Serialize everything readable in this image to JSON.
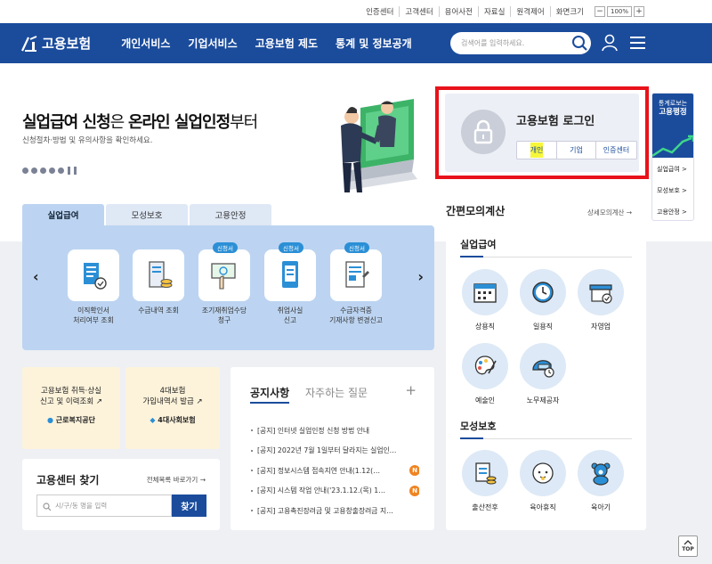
{
  "util": {
    "items": [
      "인증센터",
      "고객센터",
      "용어사전",
      "자료실",
      "원격제어",
      "화면크기"
    ],
    "zoom_minus": "−",
    "zoom_value": "100%",
    "zoom_plus": "+"
  },
  "gnb": {
    "logo": "고용보험",
    "menu": [
      "개인서비스",
      "기업서비스",
      "고용보험 제도",
      "통계 및 정보공개"
    ],
    "search_placeholder": "검색어를 입력하세요."
  },
  "hero": {
    "title_a": "실업급여 신청",
    "title_b": "은 ",
    "title_c": "온라인 실업인정",
    "title_d": "부터",
    "subtitle": "신청절차·방법 및 유의사항을 확인하세요."
  },
  "login": {
    "title": "고용보험 로그인",
    "buttons": [
      "개인",
      "기업",
      "인증센터"
    ],
    "highlight_color": "#f7f73a",
    "frame_color": "#e8121a"
  },
  "stat": {
    "line1": "통계로보는",
    "line2": "고용행정",
    "links": [
      "실업급여 >",
      "모성보호 >",
      "고용안정 >"
    ]
  },
  "tabs": [
    "실업급여",
    "모성보호",
    "고용안정"
  ],
  "services": [
    {
      "label1": "이직확인서",
      "label2": "처리여부 조회",
      "tag": ""
    },
    {
      "label1": "수급내역 조회",
      "label2": "",
      "tag": ""
    },
    {
      "label1": "조기재취업수당",
      "label2": "청구",
      "tag": "신청서"
    },
    {
      "label1": "취업사실",
      "label2": "신고",
      "tag": "신청서"
    },
    {
      "label1": "수급자격증",
      "label2": "기재사항 변경신고",
      "tag": "신청서"
    }
  ],
  "cards": [
    {
      "l1": "고용보험 취득·상실",
      "l2": "신고 및 이력조회",
      "org": "근로복지공단"
    },
    {
      "l1": "4대보험",
      "l2": "가입내역서 발급",
      "org": "4대사회보험"
    }
  ],
  "find": {
    "title": "고용센터 찾기",
    "link": "전체목록 바로가기",
    "placeholder": "시/구/동 명을 입력",
    "button": "찾기"
  },
  "notice": {
    "tab1": "공지사항",
    "tab2": "자주하는 질문",
    "more": "+",
    "items": [
      "[공지] 인터넷 실업인정 신청 방법 안내",
      "[공지] 2022년 7월 1일부터 달라지는 실업인…",
      "[공지] 정보시스템 접속지연 안내(1.12(…",
      "[공지] 시스템 작업 안내('23.1.12.(목) 1…",
      "[공지] 고용촉진장려금 및 고용창출장려금 지…"
    ],
    "new_badge": "N"
  },
  "calc": {
    "title": "간편모의계산",
    "link": "상세모의계산",
    "sec1": "실업급여",
    "sec2": "모성보호",
    "row1": [
      "상용직",
      "일용직",
      "자영업"
    ],
    "row2": [
      "예술인",
      "노무제공자"
    ],
    "row3": [
      "출산전후",
      "육아휴직",
      "육아기"
    ]
  },
  "top": "TOP"
}
